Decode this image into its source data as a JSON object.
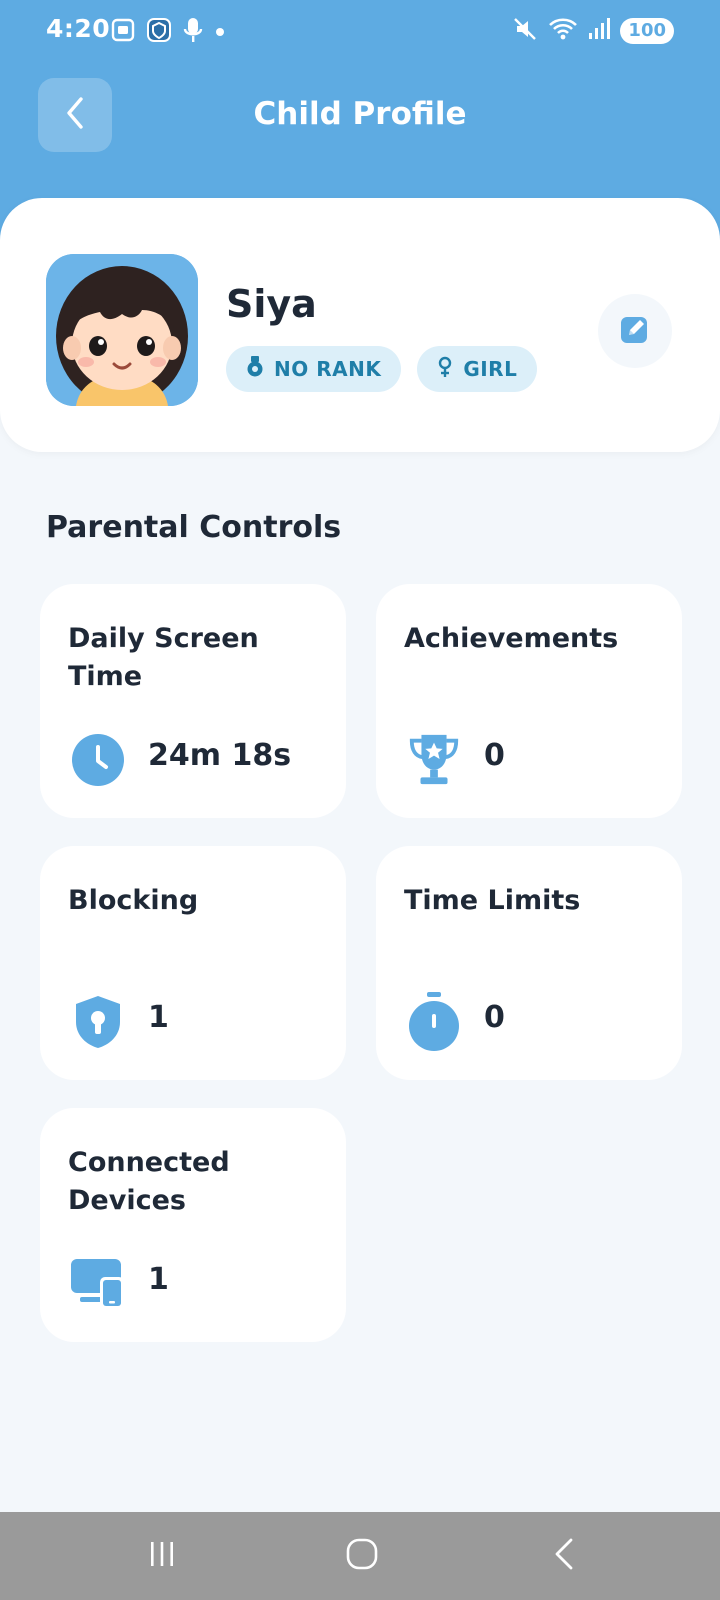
{
  "status": {
    "time": "4:20",
    "battery": "100",
    "icons_left": [
      "screenshot-icon",
      "shield-app-icon",
      "microphone-icon",
      "dot-icon"
    ],
    "icons_right": [
      "mute-icon",
      "wifi-icon",
      "signal-icon",
      "battery-icon"
    ]
  },
  "header": {
    "title": "Child Profile",
    "back_icon": "chevron-left-icon"
  },
  "profile": {
    "name": "Siya",
    "badges": [
      {
        "label": "NO RANK",
        "icon": "medal-icon"
      },
      {
        "label": "GIRL",
        "icon": "female-icon"
      }
    ],
    "edit_icon": "edit-icon"
  },
  "parental_controls": {
    "title": "Parental Controls",
    "tiles": [
      {
        "title": "Daily Screen Time",
        "value": "24m 18s",
        "icon": "clock-icon"
      },
      {
        "title": "Achievements",
        "value": "0",
        "icon": "trophy-icon"
      },
      {
        "title": "Blocking",
        "value": "1",
        "icon": "shield-icon"
      },
      {
        "title": "Time Limits",
        "value": "0",
        "icon": "timer-icon"
      },
      {
        "title": "Connected Devices",
        "value": "1",
        "icon": "devices-icon"
      }
    ]
  },
  "colors": {
    "accent": "#5eabe2",
    "badge_bg": "#dceff9",
    "badge_text": "#1f7ea8",
    "background": "#f3f7fb"
  },
  "nav": {
    "buttons": [
      "recent-apps-icon",
      "home-icon",
      "back-icon"
    ]
  }
}
